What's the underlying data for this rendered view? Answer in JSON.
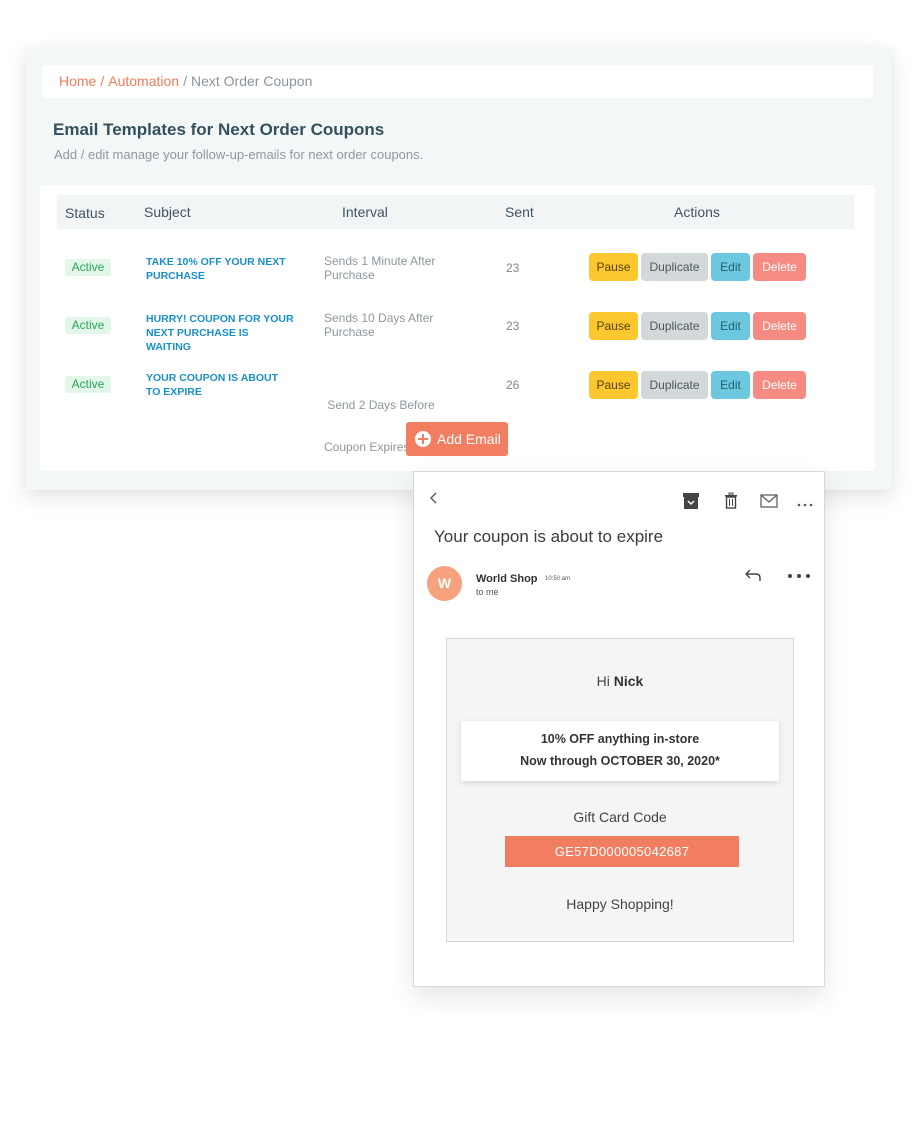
{
  "breadcrumb": {
    "home": "Home",
    "automation": "Automation",
    "current": "Next Order Coupon",
    "separator": "/"
  },
  "header": {
    "title": "Email Templates for Next Order Coupons",
    "subtitle": "Add / edit manage your follow-up-emails for next order coupons."
  },
  "table": {
    "columns": [
      "Status",
      "Subject",
      "Interval",
      "Sent",
      "Actions"
    ],
    "rows": [
      {
        "status": "Active",
        "subject_line1": "TAKE 10% OFF YOUR NEXT",
        "subject_line2": "PURCHASE",
        "interval_line1": "Sends 1 Minute After",
        "interval_line2": "Purchase",
        "sent": "23"
      },
      {
        "status": "Active",
        "subject_line1": "HURRY! COUPON FOR YOUR",
        "subject_line2": "NEXT PURCHASE IS WAITING",
        "interval_line1": "Sends 10 Days After",
        "interval_line2": "Purchase",
        "sent": "23"
      },
      {
        "status": "Active",
        "subject_line1": "YOUR COUPON IS ABOUT",
        "subject_line2": "TO EXPIRE",
        "interval_line1": " Send 2 Days Before",
        "interval_line2": "Coupon Expires",
        "sent": "26"
      }
    ],
    "actions": {
      "pause": "Pause",
      "duplicate": "Duplicate",
      "edit": "Edit",
      "delete": "Delete"
    },
    "add_email": "Add Email"
  },
  "email_preview": {
    "subject": "Your coupon is about to expire",
    "avatar_letter": "W",
    "sender": "World Shop",
    "time": "10:50 am",
    "to": "to me",
    "greeting_prefix": "Hi",
    "greeting_name": "Nick",
    "offer_line1": "10% OFF anything in-store",
    "offer_line2": "Now through OCTOBER 30, 2020*",
    "gift_label": "Gift Card Code",
    "gift_code": "GE57D000005042687",
    "sign_off": "Happy Shopping!"
  },
  "colors": {
    "accent": "#f27e62",
    "link": "#1a8fc9",
    "active": "#2aa658",
    "pause": "#fcc72f",
    "duplicate": "#d3d8db",
    "edit": "#6cc8df",
    "delete": "#f58b83"
  },
  "icons": [
    "back-icon",
    "archive-icon",
    "trash-icon",
    "mail-icon",
    "more-icon",
    "reply-icon",
    "plus-circle-icon"
  ]
}
